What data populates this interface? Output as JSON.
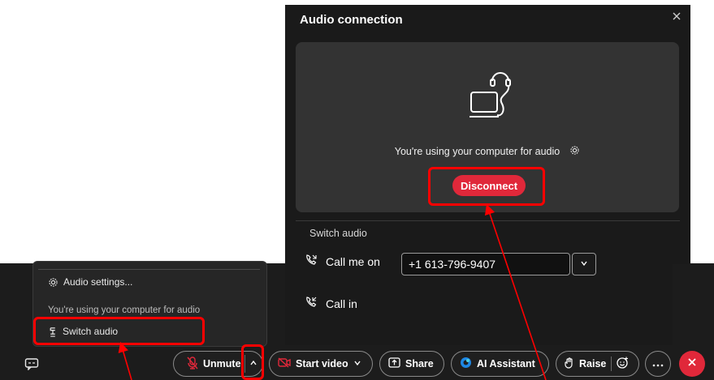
{
  "dialog": {
    "title": "Audio connection",
    "status_text": "You're using your computer for audio",
    "disconnect_label": "Disconnect",
    "section_title": "Switch audio",
    "call_me_label": "Call me on",
    "phone_value": "+1  613-796-9407",
    "call_in_label": "Call in"
  },
  "audio_menu": {
    "settings_label": "Audio settings...",
    "status_text": "You're using your computer for audio",
    "switch_label": "Switch audio"
  },
  "controls": {
    "unmute_label": "Unmute",
    "start_video_label": "Start video",
    "share_label": "Share",
    "ai_label": "AI Assistant",
    "raise_label": "Raise"
  },
  "colors": {
    "accent_red": "#e0283a",
    "highlight": "#ff0000",
    "background_dark": "#1c1c1c"
  }
}
